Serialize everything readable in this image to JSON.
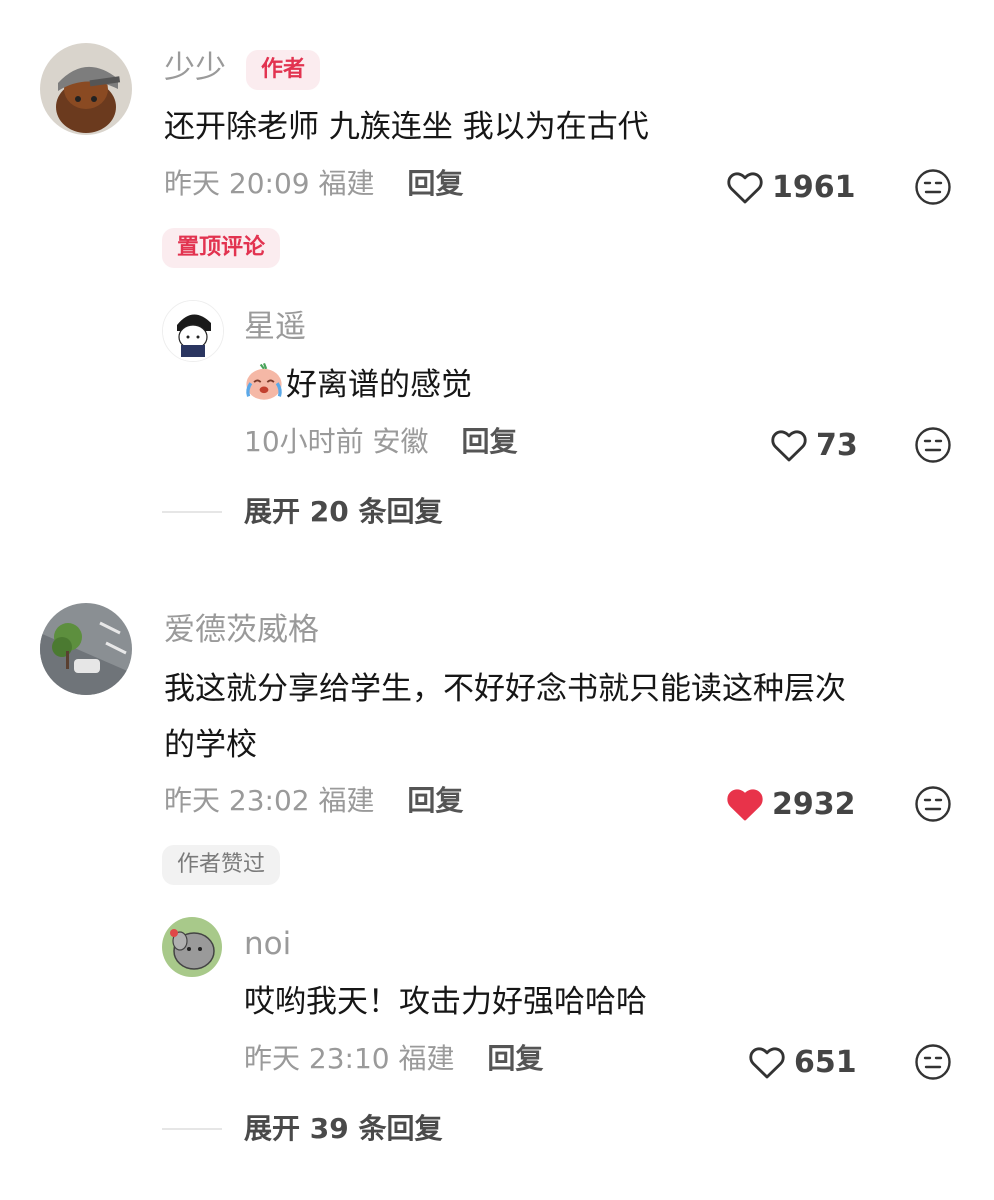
{
  "comments": [
    {
      "username": "少少",
      "author_tag": "作者",
      "text": "还开除老师 九族连坐 我以为在古代",
      "time": "昨天 20:09",
      "location": "福建",
      "reply_label": "回复",
      "likes": "1961",
      "liked": false,
      "pin_tag": "置顶评论",
      "replies": [
        {
          "username": "星遥",
          "text": "好离谱的感觉",
          "time": "10小时前",
          "location": "安徽",
          "reply_label": "回复",
          "likes": "73"
        }
      ],
      "expand_label": "展开 20 条回复"
    },
    {
      "username": "爱德茨威格",
      "text_line1": "我这就分享给学生，不好好念书就只能读这种层次",
      "text_line2": "的学校",
      "time": "昨天 23:02",
      "location": "福建",
      "reply_label": "回复",
      "likes": "2932",
      "liked": true,
      "liked_by_author_tag": "作者赞过",
      "replies": [
        {
          "username": "noi",
          "text": "哎哟我天！攻击力好强哈哈哈",
          "time": "昨天 23:10",
          "location": "福建",
          "reply_label": "回复",
          "likes": "651"
        }
      ],
      "expand_label": "展开 39 条回复"
    }
  ],
  "colors": {
    "liked_heart": "#e8334a",
    "author_badge": "#e23350",
    "meta_text": "#9a9a9a"
  },
  "icons": {
    "like": "heart-outline-icon",
    "liked": "heart-filled-icon",
    "dislike": "meh-face-icon",
    "crying_emoji": "crying-face-emoji"
  }
}
